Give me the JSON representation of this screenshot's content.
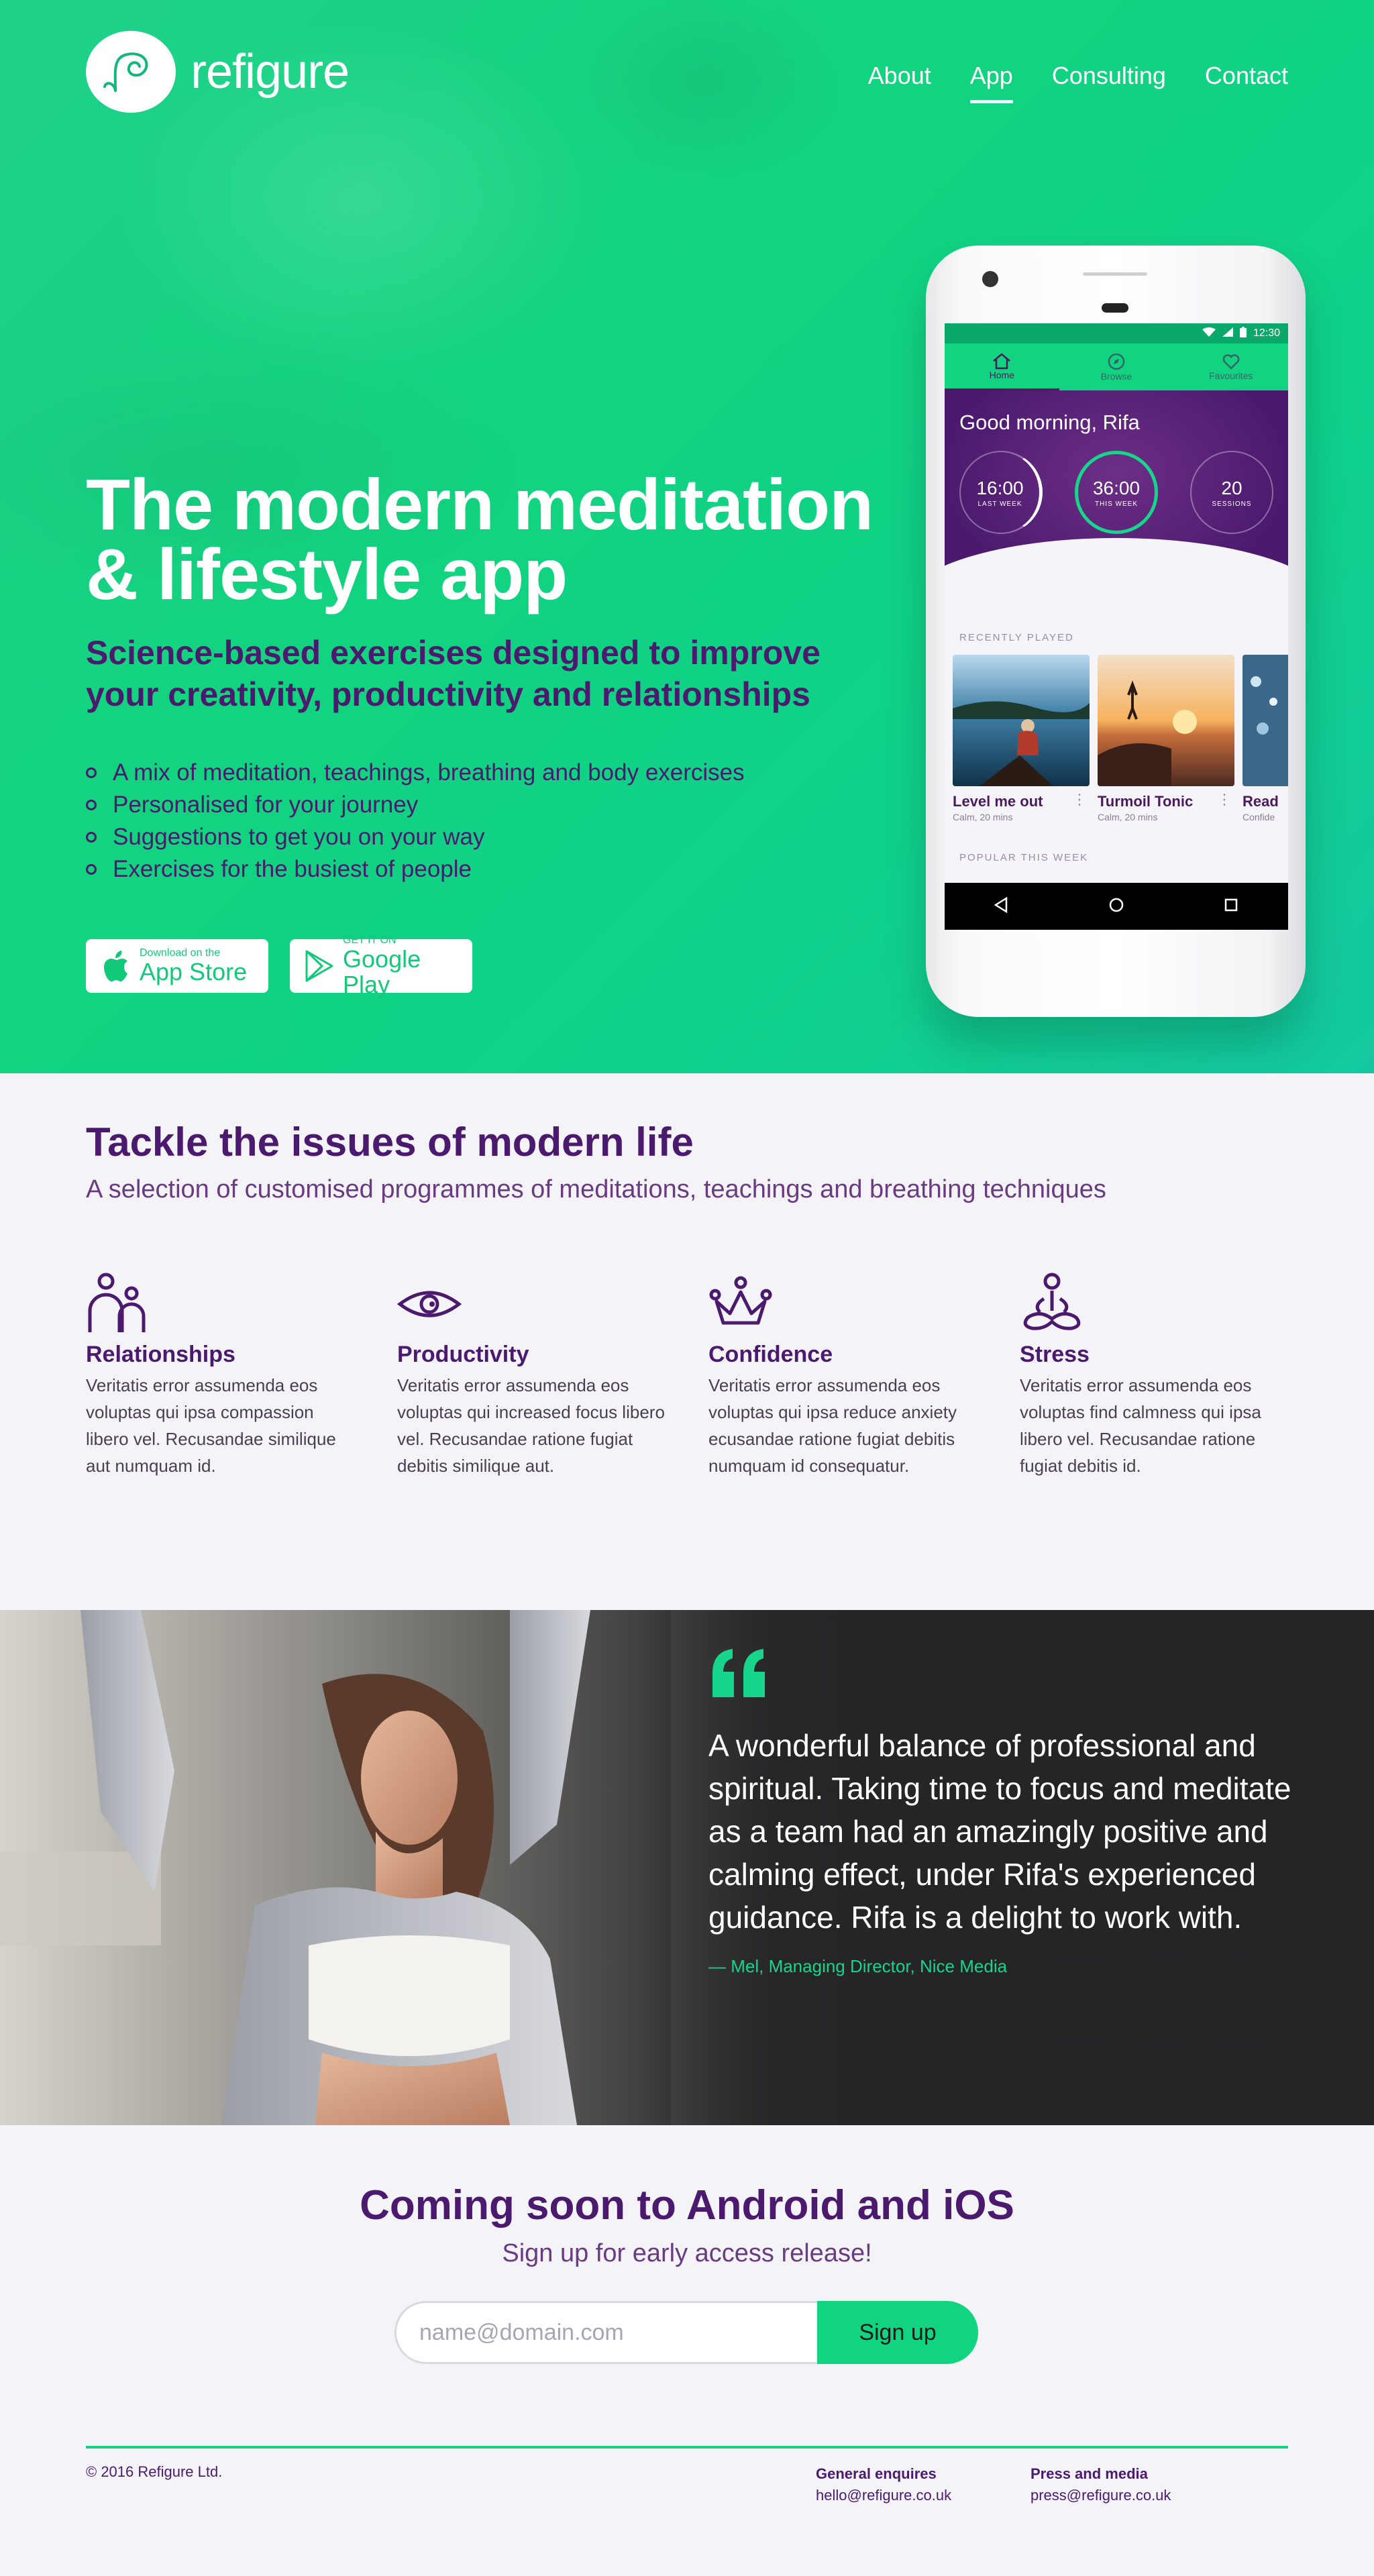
{
  "brand": {
    "name": "refigure"
  },
  "nav": {
    "items": [
      {
        "label": "About"
      },
      {
        "label": "App"
      },
      {
        "label": "Consulting"
      },
      {
        "label": "Contact"
      }
    ]
  },
  "hero": {
    "title_line1": "The modern meditation",
    "title_line2": "& lifestyle app",
    "subtitle_line1": "Science-based exercises designed to improve",
    "subtitle_line2": "your creativity, productivity and relationships",
    "bullets": [
      "A mix of meditation, teachings, breathing and body exercises",
      "Personalised for your journey",
      "Suggestions to get you on your way",
      "Exercises for the busiest of people"
    ],
    "app_store": {
      "small": "Download on the",
      "big": "App Store"
    },
    "google_play": {
      "small": "GET IT ON",
      "big": "Google Play"
    }
  },
  "phone": {
    "time": "12:30",
    "tabs": [
      "Home",
      "Browse",
      "Favourites"
    ],
    "greeting": "Good morning, Rifa",
    "stats": [
      {
        "value": "16:00",
        "label": "LAST WEEK"
      },
      {
        "value": "36:00",
        "label": "THIS WEEK"
      },
      {
        "value": "20",
        "label": "SESSIONS"
      }
    ],
    "recently_played_label": "RECENTLY PLAYED",
    "cards": [
      {
        "title": "Level me out",
        "sub": "Calm, 20 mins"
      },
      {
        "title": "Turmoil Tonic",
        "sub": "Calm, 20 mins"
      },
      {
        "title": "Read",
        "sub": "Confide"
      }
    ],
    "popular_label": "POPULAR THIS WEEK"
  },
  "features": {
    "title": "Tackle the issues of modern life",
    "subtitle": "A selection of customised programmes of meditations, teachings and breathing techniques",
    "items": [
      {
        "icon": "relationships-icon",
        "title": "Relationships",
        "text": "Veritatis error assumenda eos voluptas qui ipsa compassion libero vel. Recusandae similique aut numquam id."
      },
      {
        "icon": "eye-icon",
        "title": "Productivity",
        "text": "Veritatis error assumenda eos voluptas qui increased focus libero vel. Recusandae ratione fugiat debitis similique aut."
      },
      {
        "icon": "crown-icon",
        "title": "Confidence",
        "text": "Veritatis error assumenda eos voluptas qui ipsa reduce anxiety ecusandae ratione fugiat debitis numquam id consequatur."
      },
      {
        "icon": "meditation-icon",
        "title": "Stress",
        "text": "Veritatis error assumenda eos voluptas find calmness qui ipsa libero vel. Recusandae ratione fugiat debitis id."
      }
    ]
  },
  "testimonial": {
    "quote": "A wonderful balance of professional and spiritual. Taking time to focus and meditate as a team had an amazingly positive and calming effect, under Rifa's experienced guidance. Rifa is a delight to work with.",
    "author": "— Mel, Managing Director, Nice Media"
  },
  "signup": {
    "title": "Coming soon to Android and iOS",
    "subtitle": "Sign up for early access release!",
    "placeholder": "name@domain.com",
    "button": "Sign up"
  },
  "footer": {
    "copyright": "© 2016 Refigure Ltd.",
    "contacts": [
      {
        "heading": "General enquires",
        "email": "hello@refigure.co.uk"
      },
      {
        "heading": "Press and media",
        "email": "press@refigure.co.uk"
      }
    ]
  },
  "colors": {
    "brand_green": "#12d37f",
    "brand_purple": "#4b1a6e",
    "background": "#f4f4f8"
  }
}
